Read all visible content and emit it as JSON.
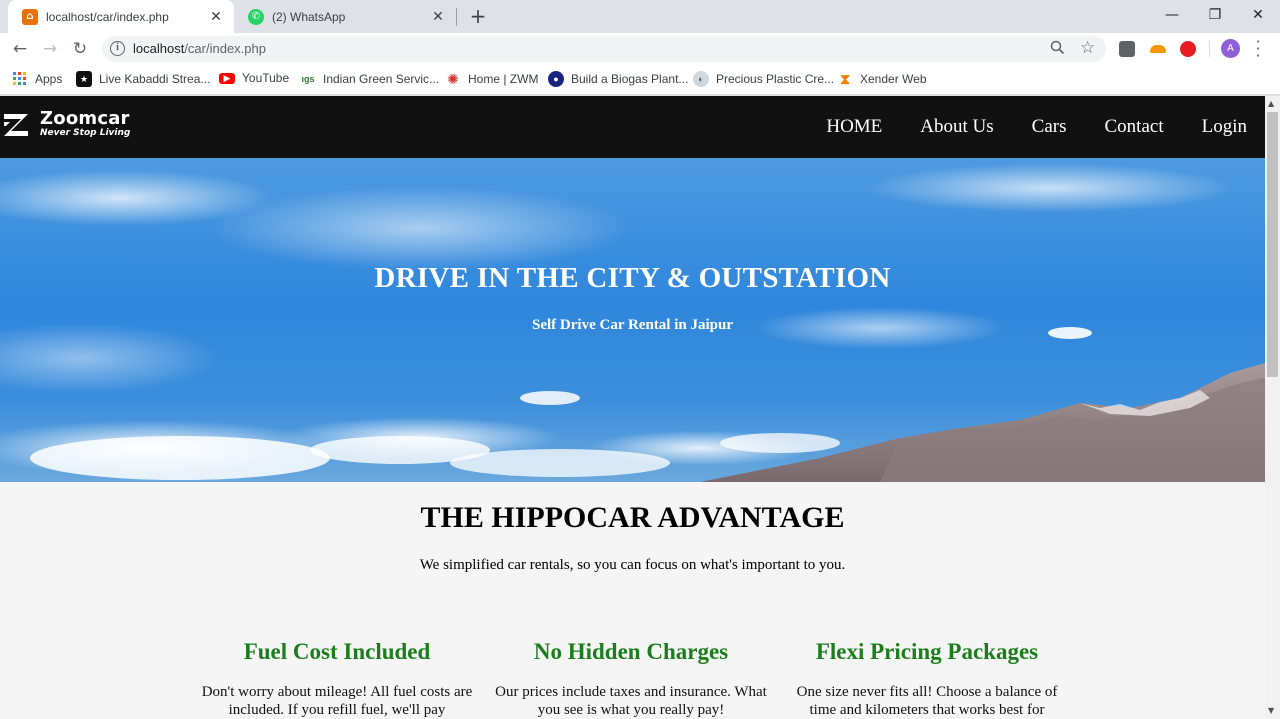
{
  "browser": {
    "tabs": [
      {
        "title": "localhost/car/index.php",
        "active": true,
        "favicon_color": "#e8710a"
      },
      {
        "title": "(2) WhatsApp",
        "active": false,
        "favicon_color": "#25d366"
      }
    ],
    "url_host": "localhost",
    "url_path": "/car/index.php",
    "profile_initial": "A",
    "bookmarks": [
      {
        "label": "Apps",
        "icon": "apps-grid-icon"
      },
      {
        "label": "Live Kabaddi Strea...",
        "icon": "kabaddi-icon"
      },
      {
        "label": "YouTube",
        "icon": "youtube-icon"
      },
      {
        "label": "Indian Green Servic...",
        "icon": "igs-icon"
      },
      {
        "label": "Home | ZWM",
        "icon": "zwm-icon"
      },
      {
        "label": "Build a Biogas Plant...",
        "icon": "biogas-icon"
      },
      {
        "label": "Precious Plastic Cre...",
        "icon": "precious-plastic-icon"
      },
      {
        "label": "Xender Web",
        "icon": "xender-icon"
      }
    ]
  },
  "site": {
    "logo_name": "Zoomcar",
    "logo_tagline": "Never Stop Living",
    "nav": [
      "HOME",
      "About Us",
      "Cars",
      "Contact",
      "Login"
    ],
    "hero_title": "DRIVE IN THE CITY & OUTSTATION",
    "hero_subtitle": "Self Drive Car Rental in Jaipur",
    "advantage_title": "THE HIPPOCAR ADVANTAGE",
    "advantage_subtitle": "We simplified car rentals, so you can focus on what's important to you.",
    "features": [
      {
        "title": "Fuel Cost Included",
        "text": "Don't worry about mileage! All fuel costs are included. If you refill fuel, we'll pay"
      },
      {
        "title": "No Hidden Charges",
        "text": "Our prices include taxes and insurance. What you see is what you really pay!"
      },
      {
        "title": "Flexi Pricing Packages",
        "text": "One size never fits all! Choose a balance of time and kilometers that works best for"
      }
    ],
    "colors": {
      "nav_bg": "#111111",
      "feature_title": "#1b7d1b",
      "page_bg": "#f5f5f5"
    }
  }
}
